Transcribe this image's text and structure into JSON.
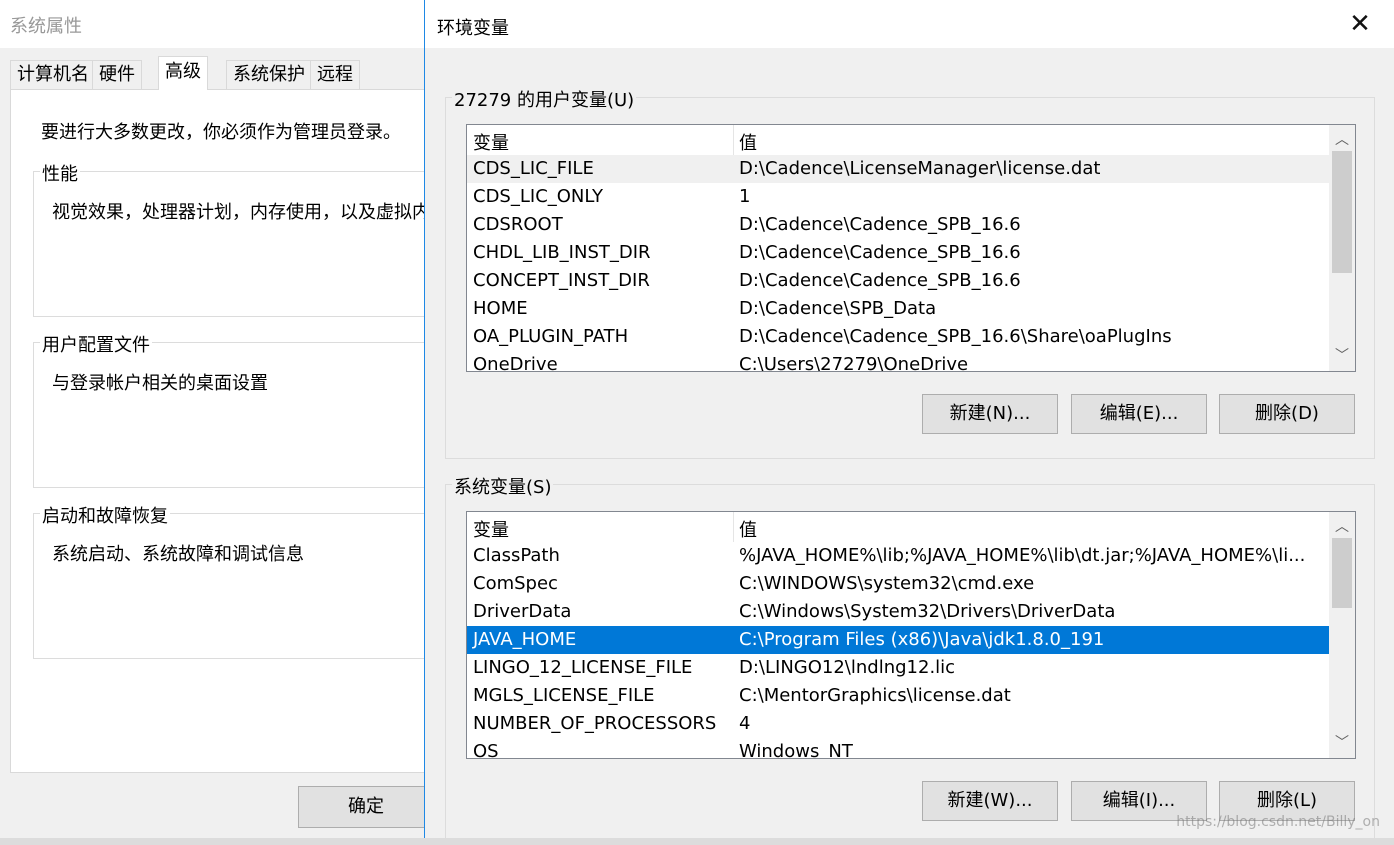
{
  "sysprops": {
    "title": "系统属性",
    "tabs": [
      {
        "label": "计算机名"
      },
      {
        "label": "硬件"
      },
      {
        "label": "高级"
      },
      {
        "label": "系统保护"
      },
      {
        "label": "远程"
      }
    ],
    "admin_note": "要进行大多数更改，你必须作为管理员登录。",
    "groups": {
      "performance": {
        "title": "性能",
        "desc": "视觉效果，处理器计划，内存使用，以及虚拟内"
      },
      "profiles": {
        "title": "用户配置文件",
        "desc": "与登录帐户相关的桌面设置"
      },
      "startup": {
        "title": "启动和故障恢复",
        "desc": "系统启动、系统故障和调试信息"
      }
    },
    "ok_label": "确定"
  },
  "envwin": {
    "title": "环境变量",
    "close_icon": "close-icon",
    "user": {
      "title": "27279 的用户变量(U)",
      "col_var": "变量",
      "col_val": "值",
      "rows": [
        {
          "name": "CDS_LIC_FILE",
          "value": "D:\\Cadence\\LicenseManager\\license.dat"
        },
        {
          "name": "CDS_LIC_ONLY",
          "value": "1"
        },
        {
          "name": "CDSROOT",
          "value": "D:\\Cadence\\Cadence_SPB_16.6"
        },
        {
          "name": "CHDL_LIB_INST_DIR",
          "value": "D:\\Cadence\\Cadence_SPB_16.6"
        },
        {
          "name": "CONCEPT_INST_DIR",
          "value": "D:\\Cadence\\Cadence_SPB_16.6"
        },
        {
          "name": "HOME",
          "value": "D:\\Cadence\\SPB_Data"
        },
        {
          "name": "OA_PLUGIN_PATH",
          "value": "D:\\Cadence\\Cadence_SPB_16.6\\Share\\oaPlugIns"
        },
        {
          "name": "OneDrive",
          "value": "C:\\Users\\27279\\OneDrive"
        }
      ],
      "buttons": {
        "new": "新建(N)...",
        "edit": "编辑(E)...",
        "delete": "删除(D)"
      }
    },
    "system": {
      "title": "系统变量(S)",
      "col_var": "变量",
      "col_val": "值",
      "rows": [
        {
          "name": "ClassPath",
          "value": "%JAVA_HOME%\\lib;%JAVA_HOME%\\lib\\dt.jar;%JAVA_HOME%\\li..."
        },
        {
          "name": "ComSpec",
          "value": "C:\\WINDOWS\\system32\\cmd.exe"
        },
        {
          "name": "DriverData",
          "value": "C:\\Windows\\System32\\Drivers\\DriverData"
        },
        {
          "name": "JAVA_HOME",
          "value": "C:\\Program Files (x86)\\Java\\jdk1.8.0_191"
        },
        {
          "name": "LINGO_12_LICENSE_FILE",
          "value": "D:\\LINGO12\\lndlng12.lic"
        },
        {
          "name": "MGLS_LICENSE_FILE",
          "value": "C:\\MentorGraphics\\license.dat"
        },
        {
          "name": "NUMBER_OF_PROCESSORS",
          "value": "4"
        },
        {
          "name": "OS",
          "value": "Windows_NT"
        }
      ],
      "buttons": {
        "new": "新建(W)...",
        "edit": "编辑(I)...",
        "delete": "删除(L)"
      }
    },
    "watermark": "https://blog.csdn.net/Billy_on"
  },
  "colors": {
    "selection": "#0078d7",
    "accent_border": "#1e88e5"
  }
}
